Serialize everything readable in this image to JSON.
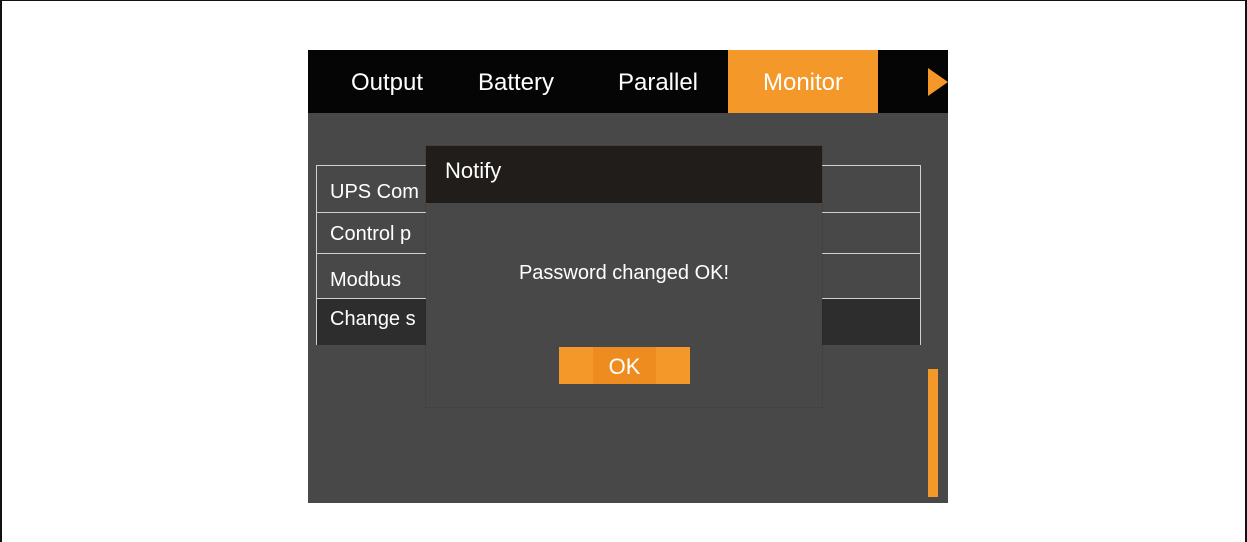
{
  "tabs": [
    {
      "label": "Output",
      "active": false
    },
    {
      "label": "Battery",
      "active": false
    },
    {
      "label": "Parallel",
      "active": false
    },
    {
      "label": "Monitor",
      "active": true
    }
  ],
  "tab_arrow_icon": "triangle-right-icon",
  "menu": {
    "items": [
      {
        "label": "UPS Com"
      },
      {
        "label": "Control p"
      },
      {
        "label": "Modbus"
      },
      {
        "label": "Change s",
        "selected": true
      }
    ]
  },
  "dialog": {
    "title": "Notify",
    "message": "Password changed OK!",
    "ok_label": "OK"
  },
  "colors": {
    "accent": "#f4982a",
    "screen_bg": "#484848",
    "tabbar_bg": "#050505",
    "dialog_header_bg": "#201d1a",
    "selected_row_bg": "#2d2d2d"
  }
}
